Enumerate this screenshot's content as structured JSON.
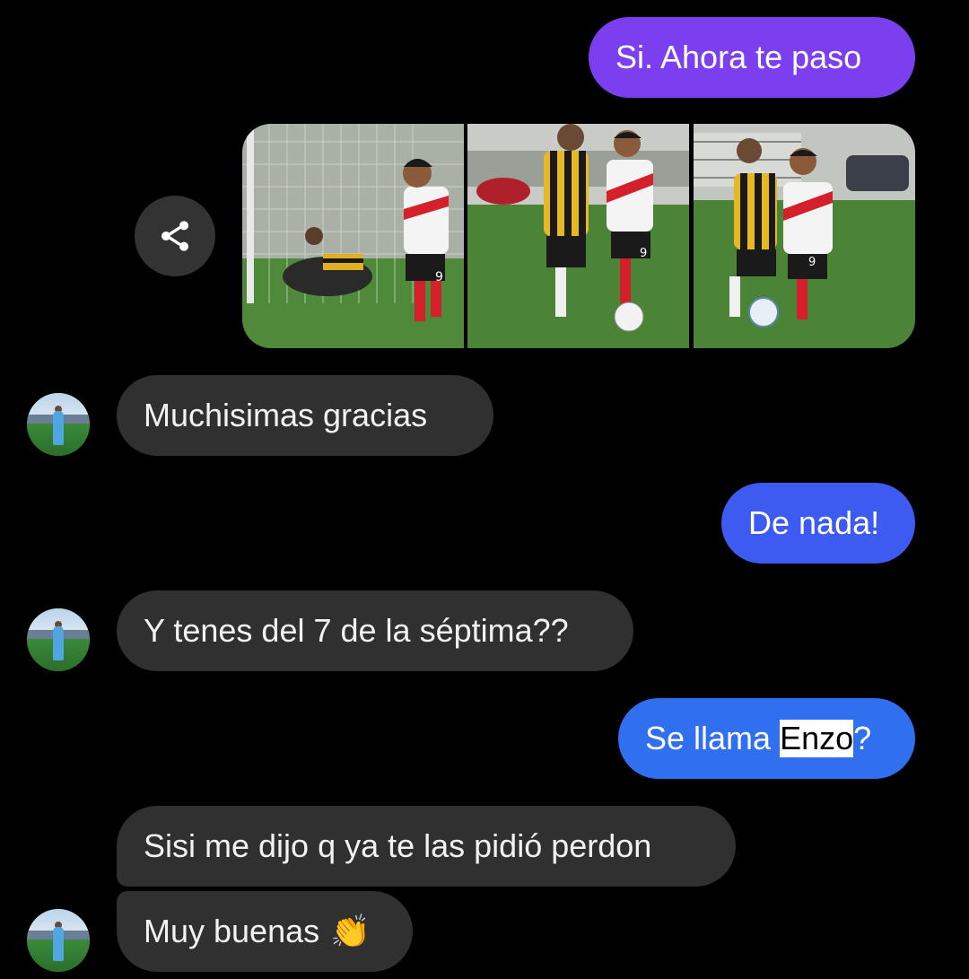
{
  "messages": {
    "m1": {
      "text": "Si. Ahora te paso"
    },
    "m2": {
      "text": "Muchisimas gracias"
    },
    "m3": {
      "text": "De nada!"
    },
    "m4": {
      "text": "Y tenes del 7 de la séptima??"
    },
    "m5": {
      "before": "Se llama ",
      "highlight": "Enzo",
      "after": "?"
    },
    "m6": {
      "text": "Sisi me dijo q ya te las pidió perdon"
    },
    "m7": {
      "text": "Muy buenas",
      "emoji": "👏"
    }
  },
  "photos": [
    {
      "name": "football-photo-1",
      "jersey_number": "9"
    },
    {
      "name": "football-photo-2",
      "jersey_number": "9"
    },
    {
      "name": "football-photo-3",
      "jersey_number": "9"
    }
  ],
  "share": {
    "icon": "share-icon"
  },
  "colors": {
    "outgoing_purple": "#7c3aed",
    "outgoing_blue_1": "#3d5af1",
    "outgoing_blue_2": "#2f6ff0",
    "incoming": "#303030",
    "background": "#000000"
  }
}
